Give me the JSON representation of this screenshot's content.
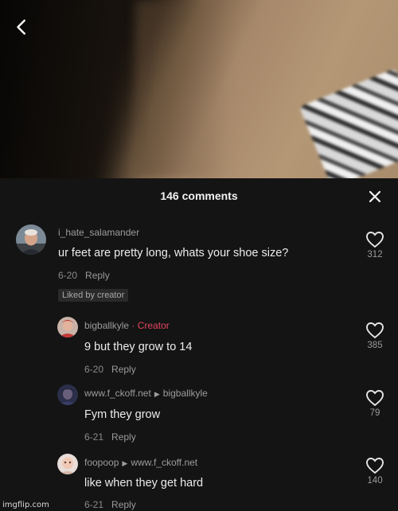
{
  "panel": {
    "comment_count": "146 comments"
  },
  "comments": [
    {
      "username": "i_hate_salamander",
      "text": "ur feet are pretty long, whats your shoe size?",
      "date": "6-20",
      "reply_label": "Reply",
      "liked_badge": "Liked by creator",
      "likes": "312"
    },
    {
      "username": "bigballkyle",
      "creator_label": "· Creator",
      "text": "9 but they grow to 14",
      "date": "6-20",
      "reply_label": "Reply",
      "likes": "385"
    },
    {
      "username": "www.f_ckoff.net",
      "reply_to": "bigballkyle",
      "text": "Fym they grow",
      "date": "6-21",
      "reply_label": "Reply",
      "likes": "79"
    },
    {
      "username": "foopoop",
      "reply_to": "www.f_ckoff.net",
      "text": "like when they get hard",
      "date": "6-21",
      "reply_label": "Reply",
      "likes": "140"
    }
  ],
  "watermark": "imgflip.com",
  "colors": {
    "background": "#141414",
    "creator_accent": "#e0455f",
    "muted_text": "#9c9c9c"
  },
  "icons": {
    "back": "chevron-left-icon",
    "close": "close-icon",
    "like": "heart-outline-icon"
  }
}
